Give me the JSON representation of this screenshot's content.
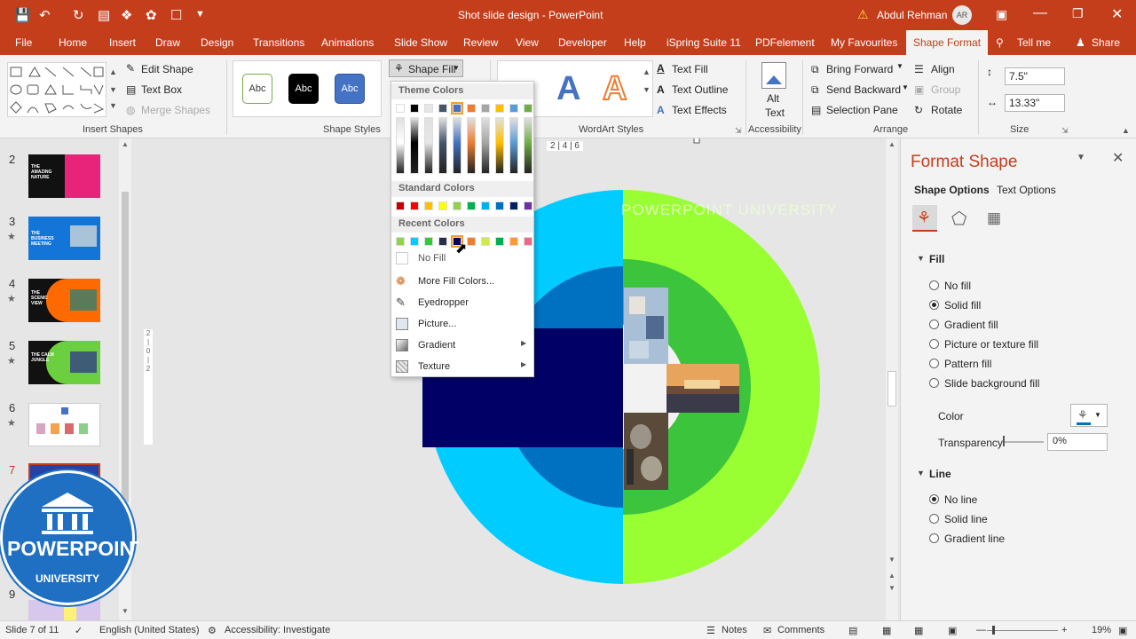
{
  "window": {
    "title": "Shot slide design  -  PowerPoint",
    "user": "Abdul Rehman",
    "user_initials": "AR",
    "warning_icon": "warning-icon"
  },
  "tabs": [
    "File",
    "Home",
    "Insert",
    "Draw",
    "Design",
    "Transitions",
    "Animations",
    "Slide Show",
    "Review",
    "View",
    "Developer",
    "Help",
    "iSpring Suite 11",
    "PDFelement",
    "My Favourites",
    "Shape Format",
    "Tell me",
    "Share"
  ],
  "active_tab": "Shape Format",
  "ribbon": {
    "insert_shapes": {
      "edit_shape": "Edit Shape",
      "text_box": "Text Box",
      "merge_shapes": "Merge Shapes",
      "group_label": "Insert Shapes"
    },
    "shape_styles": {
      "styles": [
        "Abc",
        "Abc",
        "Abc"
      ],
      "shape_fill": "Shape Fill",
      "group_label": "Shape Styles"
    },
    "wordart": {
      "text_fill": "Text Fill",
      "text_outline": "Text Outline",
      "text_effects": "Text Effects",
      "group_label": "WordArt Styles"
    },
    "accessibility": {
      "alt_text_1": "Alt",
      "alt_text_2": "Text",
      "group_label": "Accessibility"
    },
    "arrange": {
      "bring_forward": "Bring Forward",
      "send_backward": "Send Backward",
      "selection_pane": "Selection Pane",
      "align": "Align",
      "group": "Group",
      "rotate": "Rotate",
      "group_label": "Arrange"
    },
    "size": {
      "height": "7.5\"",
      "width": "13.33\"",
      "group_label": "Size"
    }
  },
  "fill_menu": {
    "theme_colors_label": "Theme Colors",
    "theme_top_row": [
      "#ffffff",
      "#000000",
      "#e7e6e6",
      "#44546a",
      "#4472c4",
      "#ed7d31",
      "#a5a5a5",
      "#ffc000",
      "#5b9bd5",
      "#70ad47"
    ],
    "standard_colors_label": "Standard Colors",
    "standard_colors": [
      "#c00000",
      "#ff0000",
      "#ffc000",
      "#ffff00",
      "#92d050",
      "#00b050",
      "#00b0f0",
      "#0070c0",
      "#002060",
      "#7030a0"
    ],
    "recent_colors_label": "Recent Colors",
    "recent_colors": [
      "#92d050",
      "#00ccff",
      "#3cc43c",
      "#262f4f",
      "#000066",
      "#ed7d31",
      "#cdea55",
      "#00b050",
      "#ff9933",
      "#ee6688"
    ],
    "no_fill": "No Fill",
    "more_colors": "More Fill Colors...",
    "eyedropper": "Eyedropper",
    "picture": "Picture...",
    "gradient": "Gradient",
    "texture": "Texture"
  },
  "thumbnails": [
    {
      "num": "2",
      "star": "",
      "text": "THE AMAZING NATURE",
      "color": "#e8247a"
    },
    {
      "num": "3",
      "star": "★",
      "text": "THE BUSINESS MEETING",
      "color": "#1475d8"
    },
    {
      "num": "4",
      "star": "★",
      "text": "THE SCENIC VIEW",
      "color": "#ff6a00"
    },
    {
      "num": "5",
      "star": "★",
      "text": "THE CALM JUNGLE",
      "color": "#6ccf3f"
    },
    {
      "num": "6",
      "star": "★",
      "text": "",
      "color": "#ffffff"
    },
    {
      "num": "7",
      "star": "",
      "text": "",
      "color": "#2244aa"
    },
    {
      "num": "9",
      "star": "",
      "text": "",
      "color": "#e0d0f0"
    }
  ],
  "watermark": {
    "line1": "POWERPOINT",
    "line2": "UNIVERSITY"
  },
  "slide": {
    "title_text": "POWERPOINT UNIVERSITY"
  },
  "ruler": {
    "label": "2 | 4 | 6"
  },
  "format_pane": {
    "title": "Format Shape",
    "tab_shape": "Shape Options",
    "tab_text": "Text Options",
    "fill_section": "Fill",
    "fill_options": [
      "No fill",
      "Solid fill",
      "Gradient fill",
      "Picture or texture fill",
      "Pattern fill",
      "Slide background fill"
    ],
    "fill_selected": 1,
    "color_label": "Color",
    "transparency_label": "Transparency",
    "transparency_value": "0%",
    "line_section": "Line",
    "line_options": [
      "No line",
      "Solid line",
      "Gradient line"
    ],
    "line_selected": 0
  },
  "status": {
    "slide_info": "Slide 7 of 11",
    "language": "English (United States)",
    "accessibility": "Accessibility: Investigate",
    "notes": "Notes",
    "comments": "Comments",
    "zoom": "19%"
  }
}
